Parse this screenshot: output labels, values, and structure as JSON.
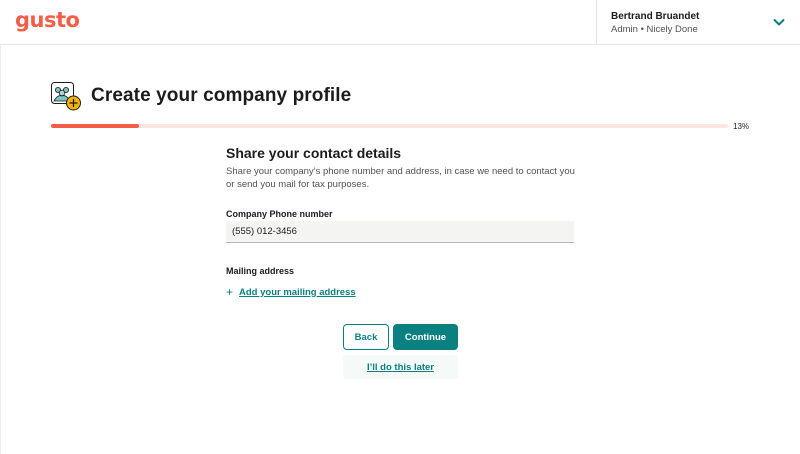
{
  "header": {
    "logo_text": "gusto",
    "account_name": "Bertrand Bruandet",
    "account_subtitle": "Admin • Nicely Done"
  },
  "page": {
    "title": "Create your company profile",
    "icon": "team-add-icon"
  },
  "progress": {
    "percent": 13,
    "percent_label": "13%"
  },
  "section": {
    "title": "Share your contact details",
    "description": "Share your company’s phone number and address, in case we need to contact you or send you mail for tax purposes."
  },
  "phone": {
    "label": "Company Phone number",
    "value": "(555) 012-3456"
  },
  "mailing": {
    "label": "Mailing address",
    "add_link": "Add your mailing address"
  },
  "actions": {
    "back": "Back",
    "continue": "Continue",
    "later": "I’ll do this later"
  },
  "colors": {
    "brand": "#f45d48",
    "accent": "#0a8080",
    "icon_badge": "#f4b400"
  }
}
